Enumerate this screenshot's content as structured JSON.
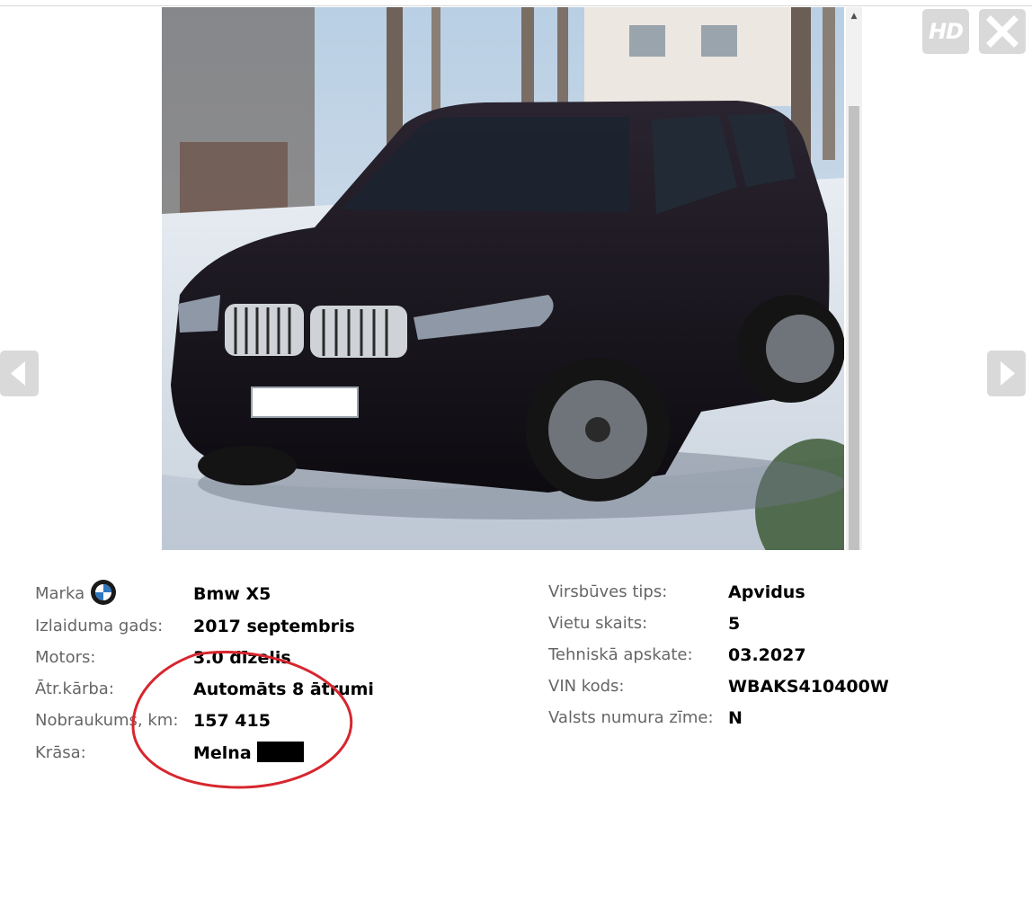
{
  "gallery": {
    "hd_label": "HD",
    "icons": {
      "close": "close-icon",
      "previous": "chevron-left-icon",
      "next": "chevron-right-icon",
      "scroll_up": "scroll-up-arrow-icon"
    }
  },
  "specs_left": {
    "make_label": "Marka",
    "make_value": "Bmw X5",
    "year_label": "Izlaiduma gads:",
    "year_value": "2017 septembris",
    "engine_label": "Motors:",
    "engine_value": "3.0 dīzelis",
    "gearbox_label": "Ātr.kārba:",
    "gearbox_value": "Automāts 8 ātrumi",
    "mileage_label": "Nobraukums, km:",
    "mileage_value": "157 415",
    "color_label": "Krāsa:",
    "color_value": "Melna"
  },
  "specs_right": {
    "body_label": "Virsbūves tips:",
    "body_value": "Apvidus",
    "seats_label": "Vietu skaits:",
    "seats_value": "5",
    "inspection_label": "Tehniskā apskate:",
    "inspection_value": "03.2027",
    "vin_label": "VIN kods:",
    "vin_value": "WBAKS410400W",
    "plate_label": "Valsts numura zīme:",
    "plate_value": "N"
  },
  "colors": {
    "annotation": "#d7262e",
    "control_bg": "#d9d9d9",
    "label": "#666666",
    "swatch": "#000000"
  }
}
